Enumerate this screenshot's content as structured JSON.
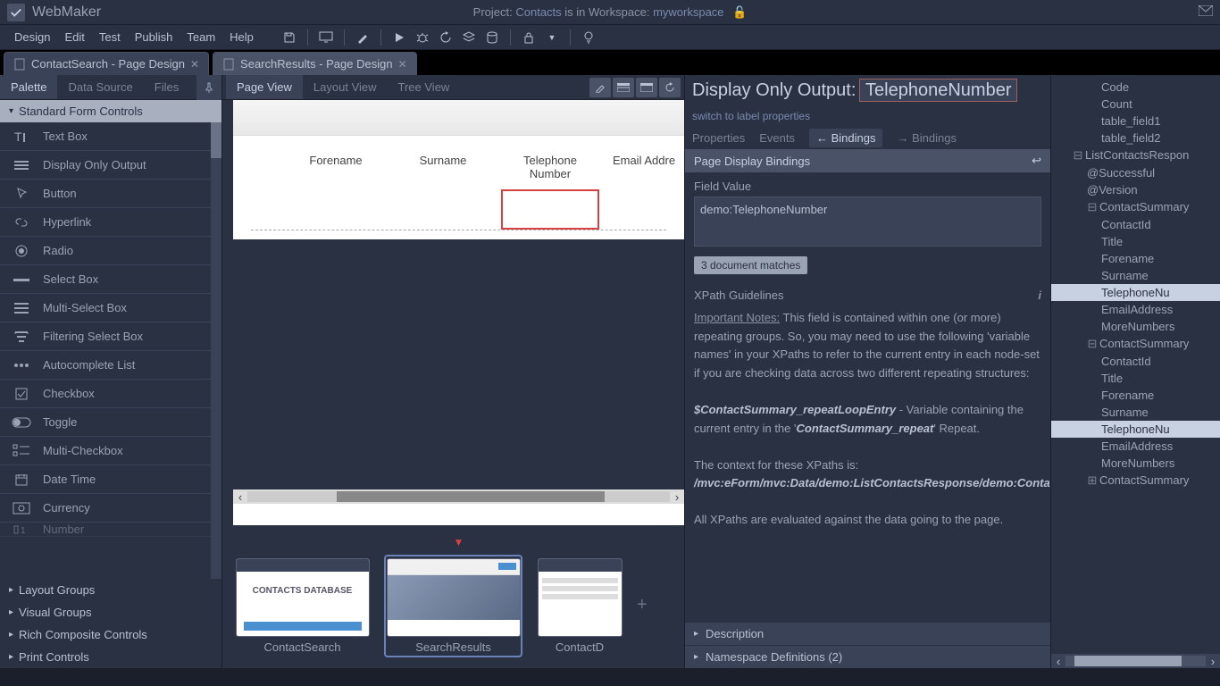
{
  "app_name": "WebMaker",
  "titlebar": {
    "project_label": "Project:",
    "project_name": "Contacts",
    "workspace_label": "is in Workspace:",
    "workspace_name": "myworkspace"
  },
  "menu": [
    "Design",
    "Edit",
    "Test",
    "Publish",
    "Team",
    "Help"
  ],
  "doc_tabs": [
    {
      "label": "ContactSearch - Page Design",
      "active": false
    },
    {
      "label": "SearchResults - Page Design",
      "active": true
    }
  ],
  "sidebar_tabs": [
    "Palette",
    "Data Source",
    "Files"
  ],
  "sidebar_active": "Palette",
  "palette_sections": {
    "open": "Standard Form Controls",
    "closed": [
      "Layout Groups",
      "Visual Groups",
      "Rich Composite Controls",
      "Print Controls"
    ]
  },
  "palette_items": [
    "Text Box",
    "Display Only Output",
    "Button",
    "Hyperlink",
    "Radio",
    "Select Box",
    "Multi-Select Box",
    "Filtering Select Box",
    "Autocomplete List",
    "Checkbox",
    "Toggle",
    "Multi-Checkbox",
    "Date Time",
    "Currency",
    "Number"
  ],
  "view_tabs": [
    "Page View",
    "Layout View",
    "Tree View"
  ],
  "view_active": "Page View",
  "canvas": {
    "columns": [
      "Forename",
      "Surname",
      "Telephone Number",
      "Email Addre"
    ],
    "selected_col": "Telephone Number"
  },
  "thumbs": [
    {
      "label": "ContactSearch",
      "caption": "CONTACTS DATABASE"
    },
    {
      "label": "SearchResults",
      "caption": ""
    },
    {
      "label": "ContactD",
      "caption": ""
    }
  ],
  "props": {
    "title_prefix": "Display Only Output:",
    "title_value": "TelephoneNumber",
    "switch_link": "switch to label properties",
    "tabs": [
      "Properties",
      "Events",
      "← Bindings",
      "→ Bindings"
    ],
    "tabs_active": "← Bindings",
    "section_head": "Page Display Bindings",
    "field_label": "Field Value",
    "field_value": "demo:TelephoneNumber",
    "badge": "3 document matches",
    "guidelines_title": "XPath Guidelines",
    "guidelines_notes_label": "Important Notes:",
    "guidelines_p1": "This field is contained within one (or more) repeating groups. So, you may need to use the following 'variable names' in your XPaths to refer to the current entry in each node-set if you are checking data across two different repeating structures:",
    "var_name": "$ContactSummary_repeatLoopEntry",
    "var_desc_1": " - Variable containing the current entry in the '",
    "var_repeat": "ContactSummary_repeat",
    "var_desc_2": "' Repeat.",
    "context_label": "The context for these XPaths is:",
    "context_path": "/mvc:eForm/mvc:Data/demo:ListContactsResponse/demo:ContactSummary",
    "eval_note": "All XPaths are evaluated against the data going to the page.",
    "collapse1": "Description",
    "collapse2": "Namespace Definitions (2)"
  },
  "tree": [
    {
      "label": "Code",
      "indent": 3
    },
    {
      "label": "Count",
      "indent": 3
    },
    {
      "label": "table_field1",
      "indent": 3
    },
    {
      "label": "table_field2",
      "indent": 3
    },
    {
      "label": "ListContactsRespon",
      "indent": 1,
      "toggle": "-"
    },
    {
      "label": "@Successful",
      "indent": 2
    },
    {
      "label": "@Version",
      "indent": 2
    },
    {
      "label": "ContactSummary",
      "indent": 2,
      "toggle": "-"
    },
    {
      "label": "ContactId",
      "indent": 3
    },
    {
      "label": "Title",
      "indent": 3
    },
    {
      "label": "Forename",
      "indent": 3
    },
    {
      "label": "Surname",
      "indent": 3
    },
    {
      "label": "TelephoneNu",
      "indent": 3,
      "sel": true
    },
    {
      "label": "EmailAddress",
      "indent": 3
    },
    {
      "label": "MoreNumbers",
      "indent": 3
    },
    {
      "label": "ContactSummary",
      "indent": 2,
      "toggle": "-"
    },
    {
      "label": "ContactId",
      "indent": 3
    },
    {
      "label": "Title",
      "indent": 3
    },
    {
      "label": "Forename",
      "indent": 3
    },
    {
      "label": "Surname",
      "indent": 3
    },
    {
      "label": "TelephoneNu",
      "indent": 3,
      "sel": true
    },
    {
      "label": "EmailAddress",
      "indent": 3
    },
    {
      "label": "MoreNumbers",
      "indent": 3
    },
    {
      "label": "ContactSummary",
      "indent": 2,
      "toggle": "+"
    }
  ]
}
